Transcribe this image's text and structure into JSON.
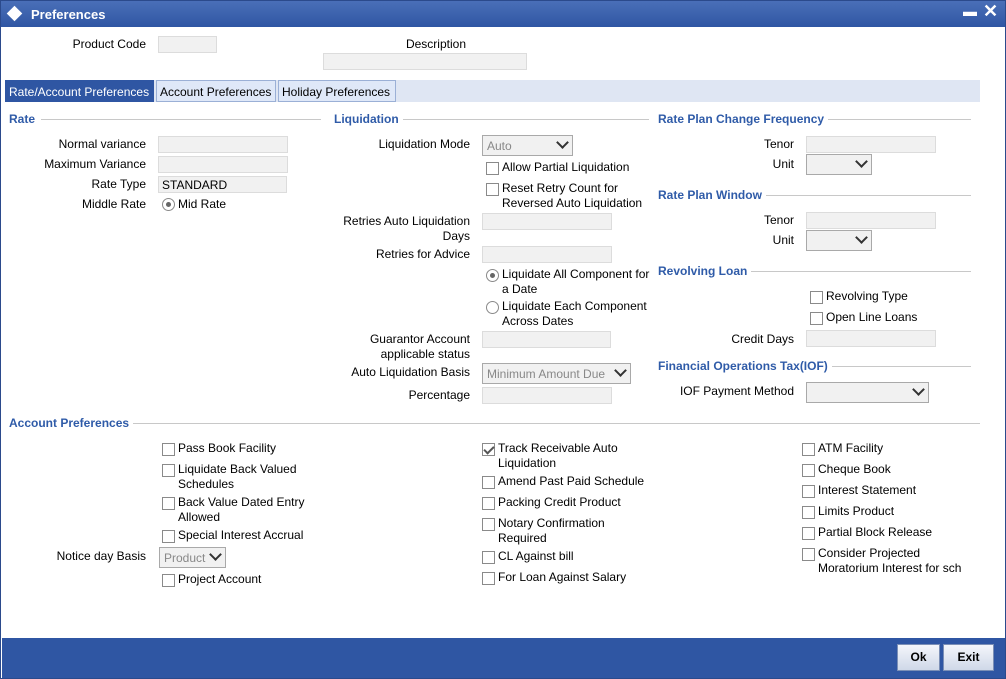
{
  "window": {
    "title": "Preferences"
  },
  "header": {
    "product_code_label": "Product Code",
    "product_code_value": "",
    "description_label": "Description",
    "description_value": ""
  },
  "tabs": [
    "Rate/Account Preferences",
    "Account Preferences",
    "Holiday Preferences"
  ],
  "rate": {
    "section": "Rate",
    "normal_variance_label": "Normal variance",
    "normal_variance_value": "",
    "maximum_variance_label": "Maximum Variance",
    "maximum_variance_value": "",
    "rate_type_label": "Rate Type",
    "rate_type_value": "STANDARD",
    "middle_rate_label": "Middle Rate",
    "mid_rate_option": "Mid Rate"
  },
  "liquidation": {
    "section": "Liquidation",
    "mode_label": "Liquidation Mode",
    "mode_value": "Auto",
    "allow_partial": "Allow Partial Liquidation",
    "reset_retry_line1": "Reset Retry Count for",
    "reset_retry_line2": "Reversed Auto Liquidation",
    "retries_auto_line1": "Retries Auto Liquidation",
    "retries_auto_line2": "Days",
    "retries_advice_label": "Retries for Advice",
    "liq_all_line1": "Liquidate All Component for",
    "liq_all_line2": "a Date",
    "liq_each_line1": "Liquidate Each Component",
    "liq_each_line2": "Across Dates",
    "guarantor_line1": "Guarantor Account",
    "guarantor_line2": "applicable status",
    "auto_basis_label": "Auto Liquidation Basis",
    "auto_basis_value": "Minimum Amount Due",
    "percentage_label": "Percentage"
  },
  "rate_plan_change": {
    "section": "Rate Plan Change Frequency",
    "tenor_label": "Tenor",
    "unit_label": "Unit"
  },
  "rate_plan_window": {
    "section": "Rate Plan Window",
    "tenor_label": "Tenor",
    "unit_label": "Unit"
  },
  "revolving_loan": {
    "section": "Revolving Loan",
    "revolving_type": "Revolving Type",
    "open_line_loans": "Open Line Loans",
    "credit_days_label": "Credit Days"
  },
  "iof": {
    "section": "Financial Operations Tax(IOF)",
    "payment_method_label": "IOF Payment Method"
  },
  "account_prefs": {
    "section": "Account Preferences",
    "col1": {
      "pass_book": "Pass Book Facility",
      "liquidate_back_line1": "Liquidate Back Valued",
      "liquidate_back_line2": "Schedules",
      "back_value_line1": "Back Value Dated Entry",
      "back_value_line2": "Allowed",
      "special_interest": "Special Interest Accrual",
      "notice_day_label": "Notice day Basis",
      "notice_day_value": "Product",
      "project_account": "Project Account"
    },
    "col2": {
      "track_line1": "Track Receivable Auto",
      "track_line2": "Liquidation",
      "amend_past": "Amend Past Paid Schedule",
      "packing_credit": "Packing Credit Product",
      "notary_line1": "Notary Confirmation",
      "notary_line2": "Required",
      "cl_against_bill": "CL Against bill",
      "loan_against_salary": "For Loan Against Salary"
    },
    "col3": {
      "atm": "ATM Facility",
      "cheque_book": "Cheque Book",
      "interest_statement": "Interest Statement",
      "limits_product": "Limits Product",
      "partial_block": "Partial Block Release",
      "consider_line1": "Consider Projected",
      "consider_line2": "Moratorium Interest for sch"
    }
  },
  "footer": {
    "ok_label": "Ok",
    "exit_label": "Exit"
  }
}
